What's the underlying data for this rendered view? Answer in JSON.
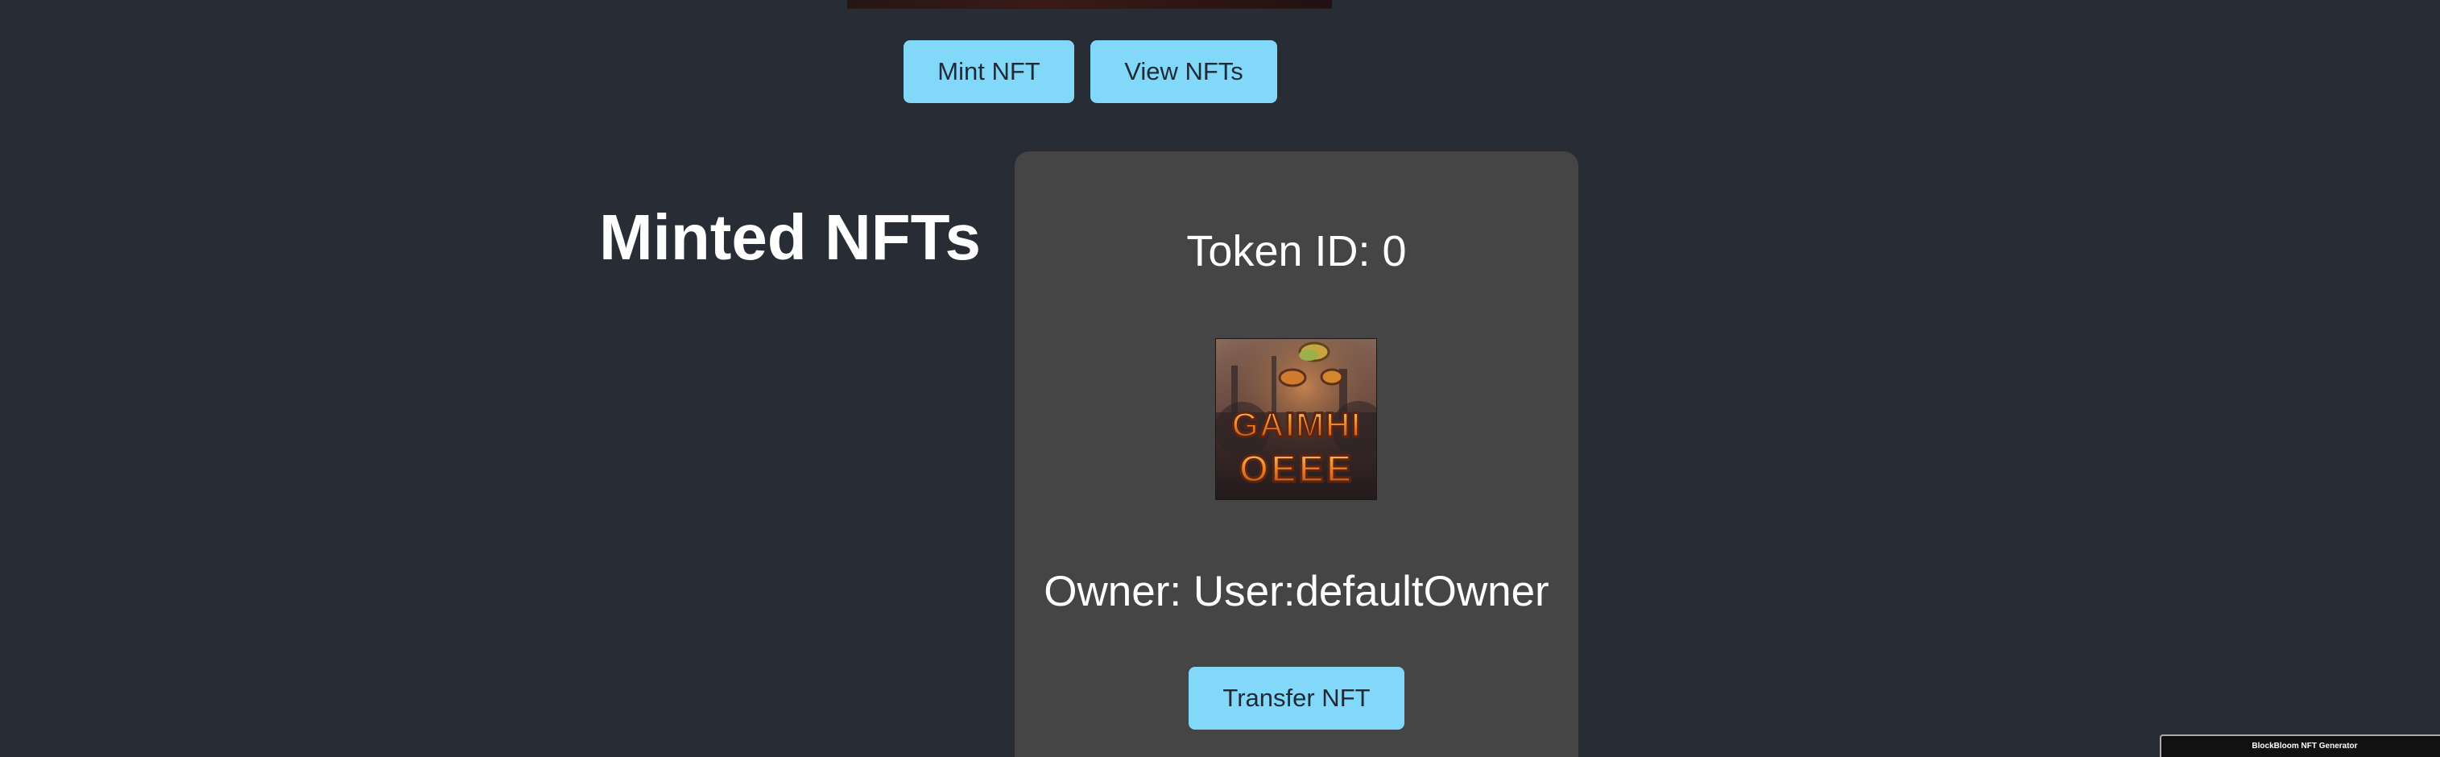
{
  "app": {
    "mini_window_title": "BlockBloom NFT Generator"
  },
  "actions": {
    "mint_label": "Mint NFT",
    "view_label": "View NFTs"
  },
  "minted_section": {
    "title": "Minted NFTs",
    "nfts": [
      {
        "token_id_text": "Token ID: 0",
        "image_caption_text": "GAIMHI OEEE",
        "owner_text": "Owner: User:defaultOwner",
        "transfer_label": "Transfer NFT"
      }
    ]
  },
  "colors": {
    "page_background": "#282c34",
    "button_background": "#81d8f8",
    "card_background": "#454545",
    "text_primary": "#ffffff"
  }
}
